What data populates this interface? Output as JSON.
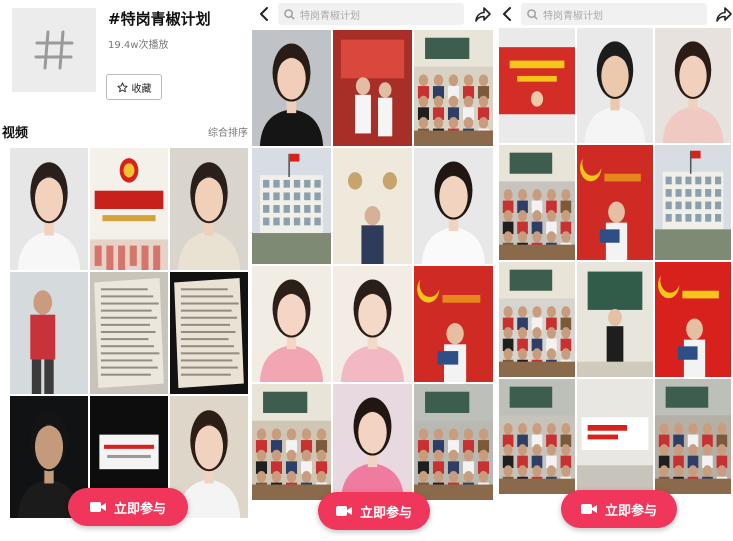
{
  "topic": {
    "title": "#特岗青椒计划",
    "plays": "19.4w次播放",
    "fav_label": "收藏",
    "section_title": "视频",
    "sort_label": "综合排序"
  },
  "search": {
    "query": "特岗青椒计划"
  },
  "join_label": "立即参与",
  "colors": {
    "accent": "#f0365a",
    "party_red": "#d8201c"
  },
  "panels": [
    {
      "tiles": [
        {
          "kind": "portrait",
          "bg": "#e6e6e6",
          "skin": "#f2d2bd",
          "hair": "#2a1f1a",
          "shirt": "#f7f7f7"
        },
        {
          "kind": "poster",
          "bg": "#f3f1ea",
          "title": "五四运动10",
          "subtitle": "青春心向党 · 建功新时代"
        },
        {
          "kind": "portrait",
          "bg": "#d9d4cc",
          "skin": "#f0d0b8",
          "hair": "#2a1f1a",
          "shirt": "#e9e2d2"
        },
        {
          "kind": "person",
          "bg": "#c9cfd4",
          "shirt": "#c8323a"
        },
        {
          "kind": "paper",
          "bg": "#c8c4bc"
        },
        {
          "kind": "paper-dark",
          "bg": "#121212"
        },
        {
          "kind": "portrait",
          "bg": "#101214",
          "skin": "#c49a7c",
          "hair": "#141414",
          "shirt": "#1b1b1b"
        },
        {
          "kind": "slide",
          "bg": "#0d0d0d"
        },
        {
          "kind": "portrait",
          "bg": "#ded6c9",
          "skin": "#f1d2bf",
          "hair": "#2c1d16",
          "shirt": "#f4f4f4"
        }
      ]
    },
    {
      "tiles": [
        {
          "kind": "portrait",
          "bg": "#bfc3c8",
          "skin": "#f1ceb9",
          "hair": "#281c15",
          "shirt": "#151515"
        },
        {
          "kind": "stage",
          "bg": "#b6362f"
        },
        {
          "kind": "classroom",
          "bg": "#d7d2c4"
        },
        {
          "kind": "building",
          "bg": "#dfe3e6"
        },
        {
          "kind": "wall",
          "bg": "#e9e3d6"
        },
        {
          "kind": "portrait",
          "bg": "#e8e8e8",
          "skin": "#f2d3c0",
          "hair": "#201712",
          "shirt": "#fafafa"
        },
        {
          "kind": "portrait",
          "bg": "#f1ede4",
          "skin": "#f5d6c6",
          "hair": "#2c1f18",
          "shirt": "#f2a6b4"
        },
        {
          "kind": "portrait",
          "bg": "#f2ece4",
          "skin": "#f4d8c8",
          "hair": "#2a1e18",
          "shirt": "#f3b9c2"
        },
        {
          "kind": "party",
          "bg": "#cf2a24"
        },
        {
          "kind": "classroom",
          "bg": "#cfc6b5"
        },
        {
          "kind": "portrait",
          "bg": "#e7d9df",
          "skin": "#f3d3c2",
          "hair": "#201713",
          "shirt": "#f07ba0"
        },
        {
          "kind": "students",
          "bg": "#b8b9b3"
        }
      ]
    },
    {
      "tiles": [
        {
          "kind": "banner",
          "bg": "#eeeeee"
        },
        {
          "kind": "portrait",
          "bg": "#e9e9e9",
          "skin": "#ecc8ad",
          "hair": "#1c1c1c",
          "shirt": "#f5f5f5"
        },
        {
          "kind": "portrait",
          "bg": "#e7e2dd",
          "skin": "#f1d1bd",
          "hair": "#2b1d16",
          "shirt": "#f0c9c3"
        },
        {
          "kind": "classroom",
          "bg": "#c7c4bd"
        },
        {
          "kind": "party",
          "bg": "#cf2a24"
        },
        {
          "kind": "building",
          "bg": "#c9d2d8"
        },
        {
          "kind": "classroom",
          "bg": "#d6d5cf"
        },
        {
          "kind": "teacher",
          "bg": "#e7e5dc"
        },
        {
          "kind": "party2",
          "bg": "#d8201c"
        },
        {
          "kind": "students",
          "bg": "#c6c3bb"
        },
        {
          "kind": "red-slide",
          "bg": "#e9e7e2"
        },
        {
          "kind": "students",
          "bg": "#b5b0a6"
        }
      ]
    }
  ]
}
